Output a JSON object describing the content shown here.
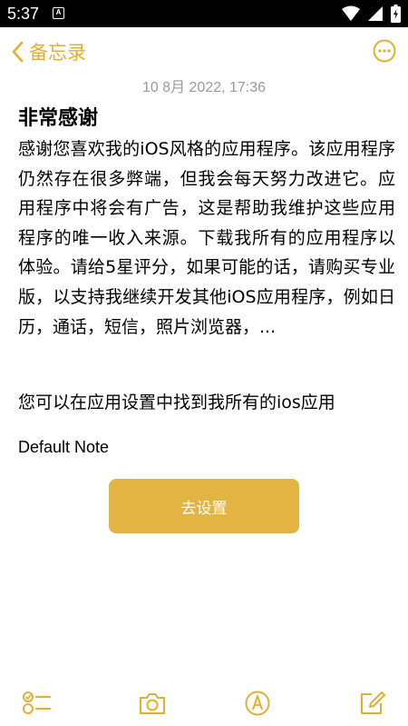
{
  "status_bar": {
    "time": "5:37",
    "notification_badge": "A",
    "icons": [
      "wifi-icon",
      "signal-icon",
      "battery-icon"
    ]
  },
  "nav": {
    "back_label": "备忘录",
    "back_icon": "chevron-left-icon",
    "more_icon": "more-horizontal-icon"
  },
  "note": {
    "timestamp": "10 8月 2022, 17:36",
    "title": "非常感谢",
    "body": "感谢您喜欢我的iOS风格的应用程序。该应用程序仍然存在很多弊端，但我会每天努力改进它。应用程序中将会有广告，这是帮助我维护这些应用程序的唯一收入来源。下载我所有的应用程序以体验。请给5星评分，如果可能的话，请购买专业版，以支持我继续开发其他iOS应用程序，例如日历，通话，短信，照片浏览器，...",
    "body2": "您可以在应用设置中找到我所有的ios应用",
    "footer": "Default Note",
    "button_label": "去设置"
  },
  "toolbar": {
    "icons": [
      "checklist-icon",
      "camera-icon",
      "markup-icon",
      "compose-icon"
    ]
  },
  "colors": {
    "accent": "#E1B033",
    "button": "#E2B443",
    "timestamp": "#9a9a9a",
    "statusbar": "#000000"
  }
}
